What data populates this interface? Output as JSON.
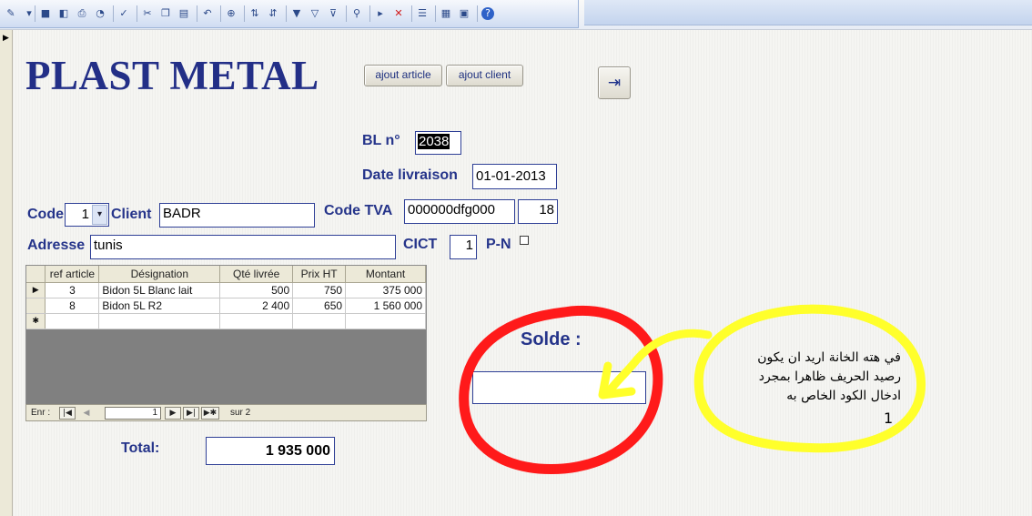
{
  "colors": {
    "accent": "#25348a",
    "annotation_red": "#ff1a1a",
    "annotation_yellow": "#ffff2b"
  },
  "toolbar": {
    "icons": [
      "view-icon",
      "dropdown-icon",
      "save-icon",
      "print-preview-icon",
      "print-icon",
      "preview-icon",
      "spellcheck-icon",
      "cut-icon",
      "copy-icon",
      "paste-icon",
      "undo-icon",
      "hyperlink-icon",
      "sort-ascending-icon",
      "sort-descending-icon",
      "filter-icon",
      "filter-form-icon",
      "apply-filter-icon",
      "find-icon",
      "new-record-icon",
      "delete-record-icon",
      "properties-icon",
      "database-window-icon",
      "new-object-icon",
      "help-icon"
    ]
  },
  "header": {
    "title": "PLAST METAL",
    "add_article_label": "ajout article",
    "add_client_label": "ajout client"
  },
  "bl": {
    "label": "BL n°",
    "value": "2038"
  },
  "delivery_date": {
    "label": "Date livraison",
    "value": "01-01-2013"
  },
  "code": {
    "label": "Code",
    "value": "1"
  },
  "client": {
    "label": "Client",
    "value": "BADR"
  },
  "tva": {
    "label": "Code TVA",
    "value": "000000dfg000",
    "rate": "18"
  },
  "address": {
    "label": "Adresse",
    "value": "tunis"
  },
  "cict": {
    "label": "CICT",
    "value": "1"
  },
  "pn": {
    "label": "P-N"
  },
  "grid": {
    "columns": [
      "ref article",
      "Désignation",
      "Qté livrée",
      "Prix HT",
      "Montant"
    ],
    "rows": [
      {
        "ref": "3",
        "designation": "Bidon 5L Blanc lait",
        "qty": "500",
        "price": "750",
        "amount": "375 000"
      },
      {
        "ref": "8",
        "designation": "Bidon 5L R2",
        "qty": "2 400",
        "price": "650",
        "amount": "1 560 000"
      }
    ],
    "nav": {
      "label": "Enr :",
      "position": "1",
      "of_label": "sur 2"
    }
  },
  "total": {
    "label": "Total:",
    "value": "1 935 000"
  },
  "solde": {
    "label": "Solde :",
    "value": ""
  },
  "annotation": {
    "lines": [
      "في هته الخانة اريد ان يكون",
      "رصيد الحريف ظاهرا بمجرد",
      "ادخال الكود الخاص به"
    ],
    "mark": "1"
  }
}
